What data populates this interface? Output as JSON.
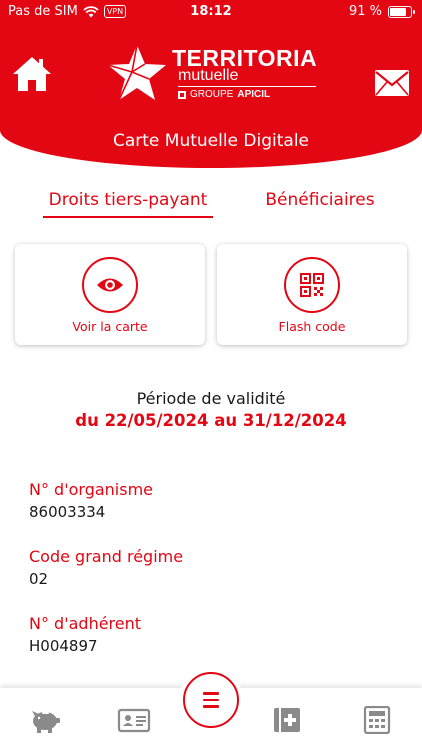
{
  "status_bar": {
    "carrier": "Pas de SIM",
    "vpn": "VPN",
    "time": "18:12",
    "battery": "91 %",
    "battery_level": 0.91
  },
  "header": {
    "logo_name": "TERRITORIA",
    "logo_sub": "mutuelle",
    "logo_group_prefix": "GROUPE",
    "logo_group_name": "APICIL",
    "title": "Carte Mutuelle Digitale",
    "home_icon": "home-icon",
    "mail_icon": "mail-icon"
  },
  "tabs": [
    {
      "label": "Droits tiers-payant",
      "active": true
    },
    {
      "label": "Bénéficiaires",
      "active": false
    }
  ],
  "cards": [
    {
      "label": "Voir la carte",
      "icon": "eye-icon"
    },
    {
      "label": "Flash code",
      "icon": "qr-code-icon"
    }
  ],
  "validity": {
    "label": "Période de validité",
    "dates": "du 22/05/2024 au 31/12/2024"
  },
  "fields": [
    {
      "label": "N° d'organisme",
      "value": "86003334"
    },
    {
      "label": "Code grand régime",
      "value": "02"
    },
    {
      "label": "N° d'adhérent",
      "value": "H004897"
    }
  ],
  "bottom_nav": [
    {
      "icon": "piggy-bank-icon"
    },
    {
      "icon": "id-card-icon"
    },
    {
      "icon": "menu-icon"
    },
    {
      "icon": "medical-book-icon"
    },
    {
      "icon": "calculator-icon"
    }
  ],
  "colors": {
    "brand_red": "#e30613",
    "text": "#1a1a1a",
    "icon_gray": "#8a8a8a"
  }
}
